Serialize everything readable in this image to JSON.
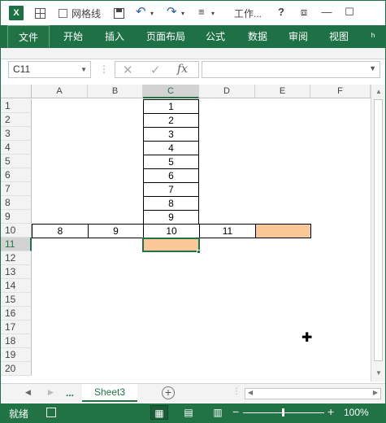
{
  "titlebar": {
    "logo": "X",
    "gridlines_label": "网格线",
    "undo": "↶",
    "redo": "↷",
    "dropdown": "▾",
    "customize": "≡",
    "title": "工作...",
    "help": "?",
    "restore": "⧈",
    "minimize": "—",
    "maximize": "☐"
  },
  "ribbon": {
    "tabs": [
      "文件",
      "开始",
      "插入",
      "页面布局",
      "公式",
      "数据",
      "审阅",
      "视图"
    ],
    "overflow": "ʰ"
  },
  "formula_bar": {
    "name_box": "C11",
    "cancel": "✕",
    "enter": "✓",
    "fx": "fx",
    "value": ""
  },
  "grid": {
    "columns": [
      "A",
      "B",
      "C",
      "D",
      "E",
      "F"
    ],
    "rows": [
      "1",
      "2",
      "3",
      "4",
      "5",
      "6",
      "7",
      "8",
      "9",
      "10",
      "11",
      "12",
      "13",
      "14",
      "15",
      "16",
      "17",
      "18",
      "19",
      "20"
    ],
    "selected_column": "C",
    "selected_row": "11",
    "c_values": [
      "1",
      "2",
      "3",
      "4",
      "5",
      "6",
      "7",
      "8",
      "9"
    ],
    "row10": {
      "A": "8",
      "B": "9",
      "C": "10",
      "D": "11",
      "E": ""
    }
  },
  "sheets": {
    "dots": "...",
    "active": "Sheet3",
    "add": "+"
  },
  "statusbar": {
    "ready": "就绪",
    "zoom": "100%",
    "minus": "−",
    "plus": "+"
  },
  "colors": {
    "brand": "#217346",
    "highlight": "#fac796"
  }
}
